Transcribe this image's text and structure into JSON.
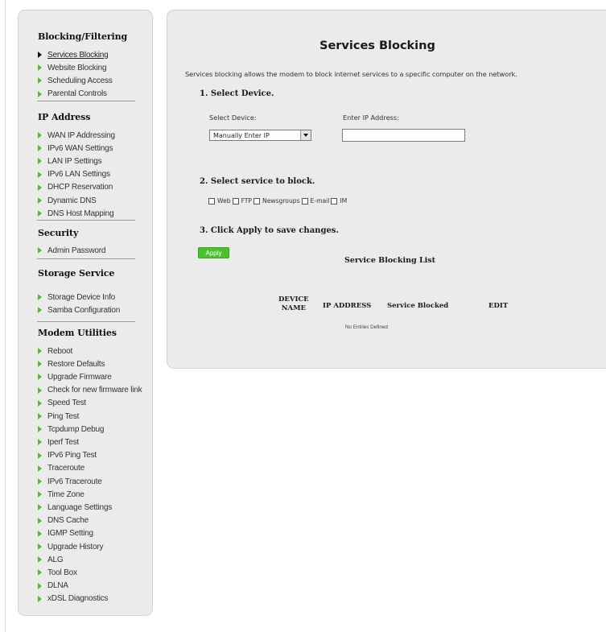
{
  "sidebar": {
    "sections": [
      {
        "title": "Blocking/Filtering",
        "items": [
          "Services Blocking",
          "Website Blocking",
          "Scheduling Access",
          "Parental Controls"
        ]
      },
      {
        "title": "IP Address",
        "items": [
          "WAN IP Addressing",
          "IPv6 WAN Settings",
          "LAN IP Settings",
          "IPv6 LAN Settings",
          "DHCP Reservation",
          "Dynamic DNS",
          "DNS Host Mapping"
        ]
      },
      {
        "title": "Security",
        "items": [
          "Admin Password"
        ]
      },
      {
        "title": "Storage Service",
        "items": [
          "Storage Device Info",
          "Samba Configuration"
        ]
      },
      {
        "title": "Modem Utilities",
        "items": [
          "Reboot",
          "Restore Defaults",
          "Upgrade Firmware",
          "Check for new firmware link",
          "Speed Test",
          "Ping Test",
          "Tcpdump Debug",
          "Iperf Test",
          "IPv6 Ping Test",
          "Traceroute",
          "IPv6 Traceroute",
          "Time Zone",
          "Language Settings",
          "DNS Cache",
          "IGMP Setting",
          "Upgrade History",
          "ALG",
          "Tool Box",
          "DLNA",
          "xDSL Diagnostics"
        ]
      }
    ],
    "active_item": "Services Blocking",
    "colors": {
      "arrow": "#4fbf2a",
      "active_arrow": "#111111"
    }
  },
  "main": {
    "title": "Services Blocking",
    "description": "Services blocking allows the modem to block internet services to a specific computer on the network.",
    "step1": {
      "heading": "1. Select Device.",
      "select_label": "Select Device:",
      "select_value": "Manually Enter IP",
      "ip_label": "Enter IP Address:",
      "ip_value": ""
    },
    "step2": {
      "heading": "2. Select service to block.",
      "services": [
        "Web",
        "FTP",
        "Newsgroups",
        "E-mail",
        "IM"
      ]
    },
    "step3": {
      "heading": "3. Click Apply to save changes.",
      "apply_label": "Apply"
    },
    "list": {
      "title": "Service Blocking List",
      "headers": {
        "device_name_line1": "DEVICE",
        "device_name_line2": "NAME",
        "ip_address": "IP ADDRESS",
        "service_blocked": "Service Blocked",
        "edit": "EDIT"
      },
      "empty_text": "No Entries Defined"
    },
    "colors": {
      "apply_button": "#4cc02f",
      "panel_bg": "#ebebeb"
    }
  }
}
